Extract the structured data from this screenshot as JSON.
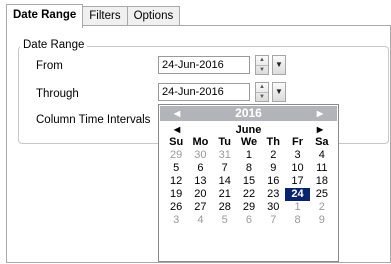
{
  "tabs": [
    "Date Range",
    "Filters",
    "Options"
  ],
  "group": {
    "title": "Date Range"
  },
  "from": {
    "label": "From",
    "value": "24-Jun-2016"
  },
  "through": {
    "label": "Through",
    "value": "24-Jun-2016"
  },
  "column_intervals": {
    "label": "Column Time Intervals"
  },
  "calendar": {
    "year": "2016",
    "month": "June",
    "weekdays": [
      "Su",
      "Mo",
      "Tu",
      "We",
      "Th",
      "Fr",
      "Sa"
    ],
    "weeks": [
      [
        "29",
        "30",
        "31",
        "1",
        "2",
        "3",
        "4"
      ],
      [
        "5",
        "6",
        "7",
        "8",
        "9",
        "10",
        "11"
      ],
      [
        "12",
        "13",
        "14",
        "15",
        "16",
        "17",
        "18"
      ],
      [
        "19",
        "20",
        "21",
        "22",
        "23",
        "24",
        "25"
      ],
      [
        "26",
        "27",
        "28",
        "29",
        "30",
        "1",
        "2"
      ],
      [
        "3",
        "4",
        "5",
        "6",
        "7",
        "8",
        "9"
      ]
    ],
    "selected": "24"
  }
}
